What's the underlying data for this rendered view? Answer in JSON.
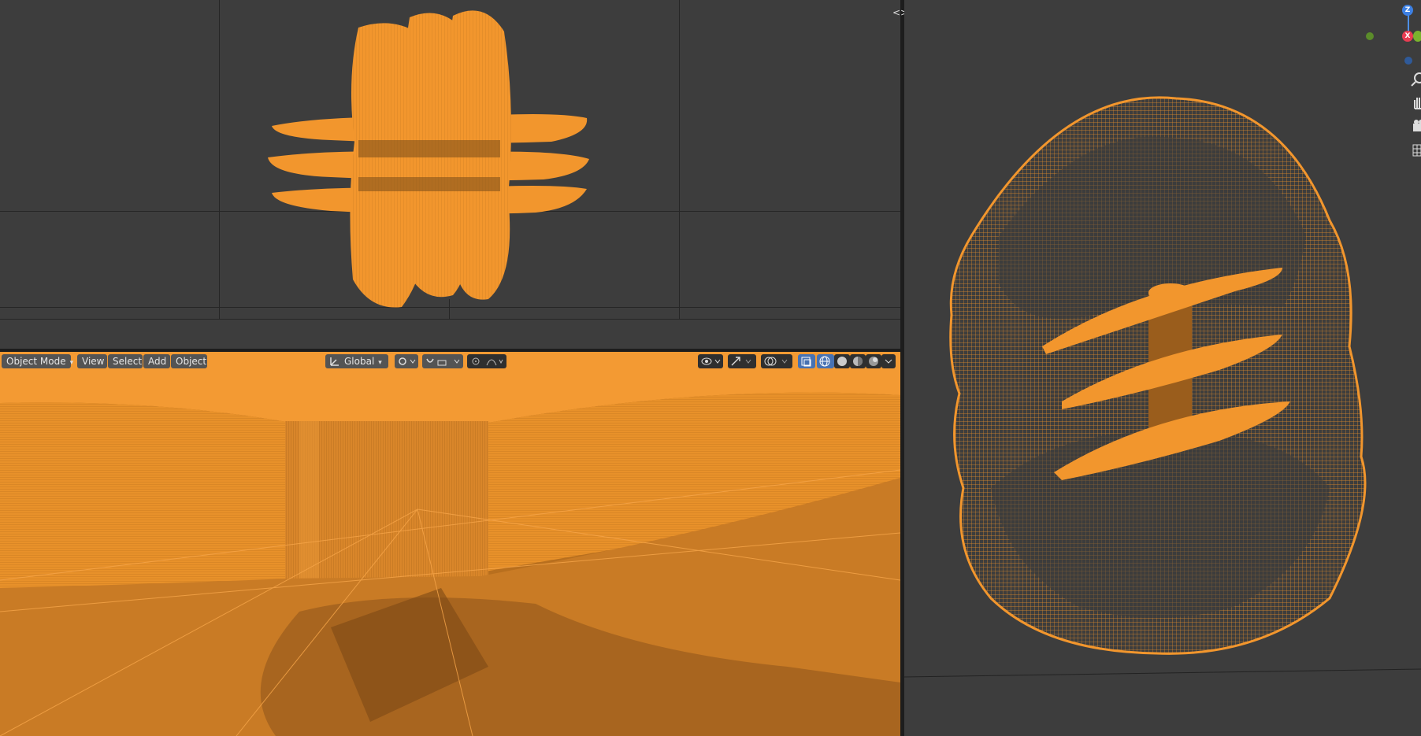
{
  "header": {
    "mode_label": "Object Mode",
    "menu": [
      "View",
      "Select",
      "Add",
      "Object"
    ],
    "orientation_label": "Global"
  },
  "gizmo": {
    "z": "Z",
    "x": "X"
  },
  "icons": {
    "transform": "transform-orientation-icon",
    "pivot": "pivot-point-icon",
    "snap": "snap-icon",
    "proportional": "proportional-edit-icon",
    "visibility": "object-visibility-icon",
    "gizmo": "gizmo-icon",
    "overlay": "overlay-icon",
    "xray": "xray-toggle-icon",
    "shading": [
      "wireframe-shading-icon",
      "solid-shading-icon",
      "material-shading-icon",
      "rendered-shading-icon"
    ],
    "nav": [
      "zoom-icon",
      "pan-hand-icon",
      "camera-icon",
      "grid-icon"
    ]
  },
  "colors": {
    "accent": "#f2962d",
    "active_button": "#4772b3",
    "background": "#3d3d3d"
  }
}
